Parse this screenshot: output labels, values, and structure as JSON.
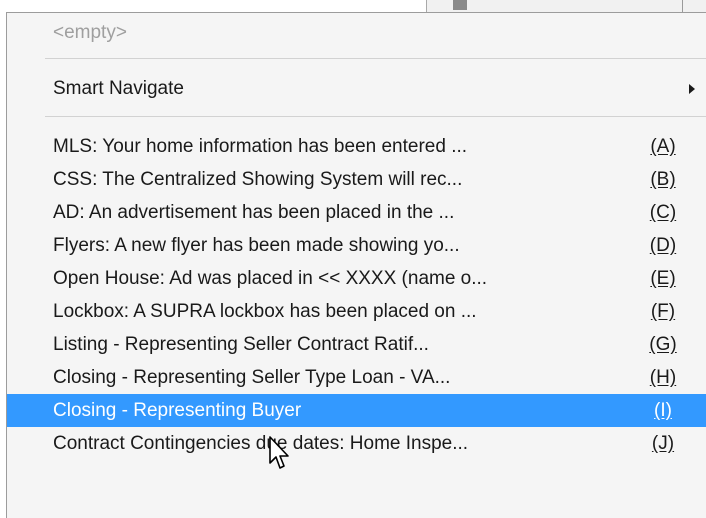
{
  "menu": {
    "empty_item": "<empty>",
    "smart_navigate": "Smart Navigate",
    "items": [
      {
        "label": "MLS:  Your home information has been entered ...",
        "shortcut": "(A)"
      },
      {
        "label": "CSS:  The Centralized Showing System will rec...",
        "shortcut": "(B)"
      },
      {
        "label": "AD:  An advertisement has been placed in the ...",
        "shortcut": "(C)"
      },
      {
        "label": "Flyers:  A new flyer has been made showing yo...",
        "shortcut": "(D)"
      },
      {
        "label": "Open House:  Ad was placed in << XXXX (name o...",
        "shortcut": "(E)"
      },
      {
        "label": "Lockbox:  A SUPRA lockbox has been placed on ...",
        "shortcut": "(F)"
      },
      {
        "label": "Listing - Representing Seller  Contract Ratif...",
        "shortcut": "(G)"
      },
      {
        "label": "Closing - Representing Seller  Type Loan - VA...",
        "shortcut": "(H)"
      },
      {
        "label": "Closing - Representing Buyer",
        "shortcut": "(I)"
      },
      {
        "label": "Contract Contingencies due dates:  Home Inspe...",
        "shortcut": "(J)"
      }
    ],
    "selected_index": 8,
    "colors": {
      "highlight": "#3399ff",
      "menu_bg": "#f5f5f5",
      "disabled_text": "#9f9f9f"
    }
  },
  "icons": {
    "submenu_arrow": "chevron-right-icon",
    "cursor": "mouse-pointer-icon"
  }
}
